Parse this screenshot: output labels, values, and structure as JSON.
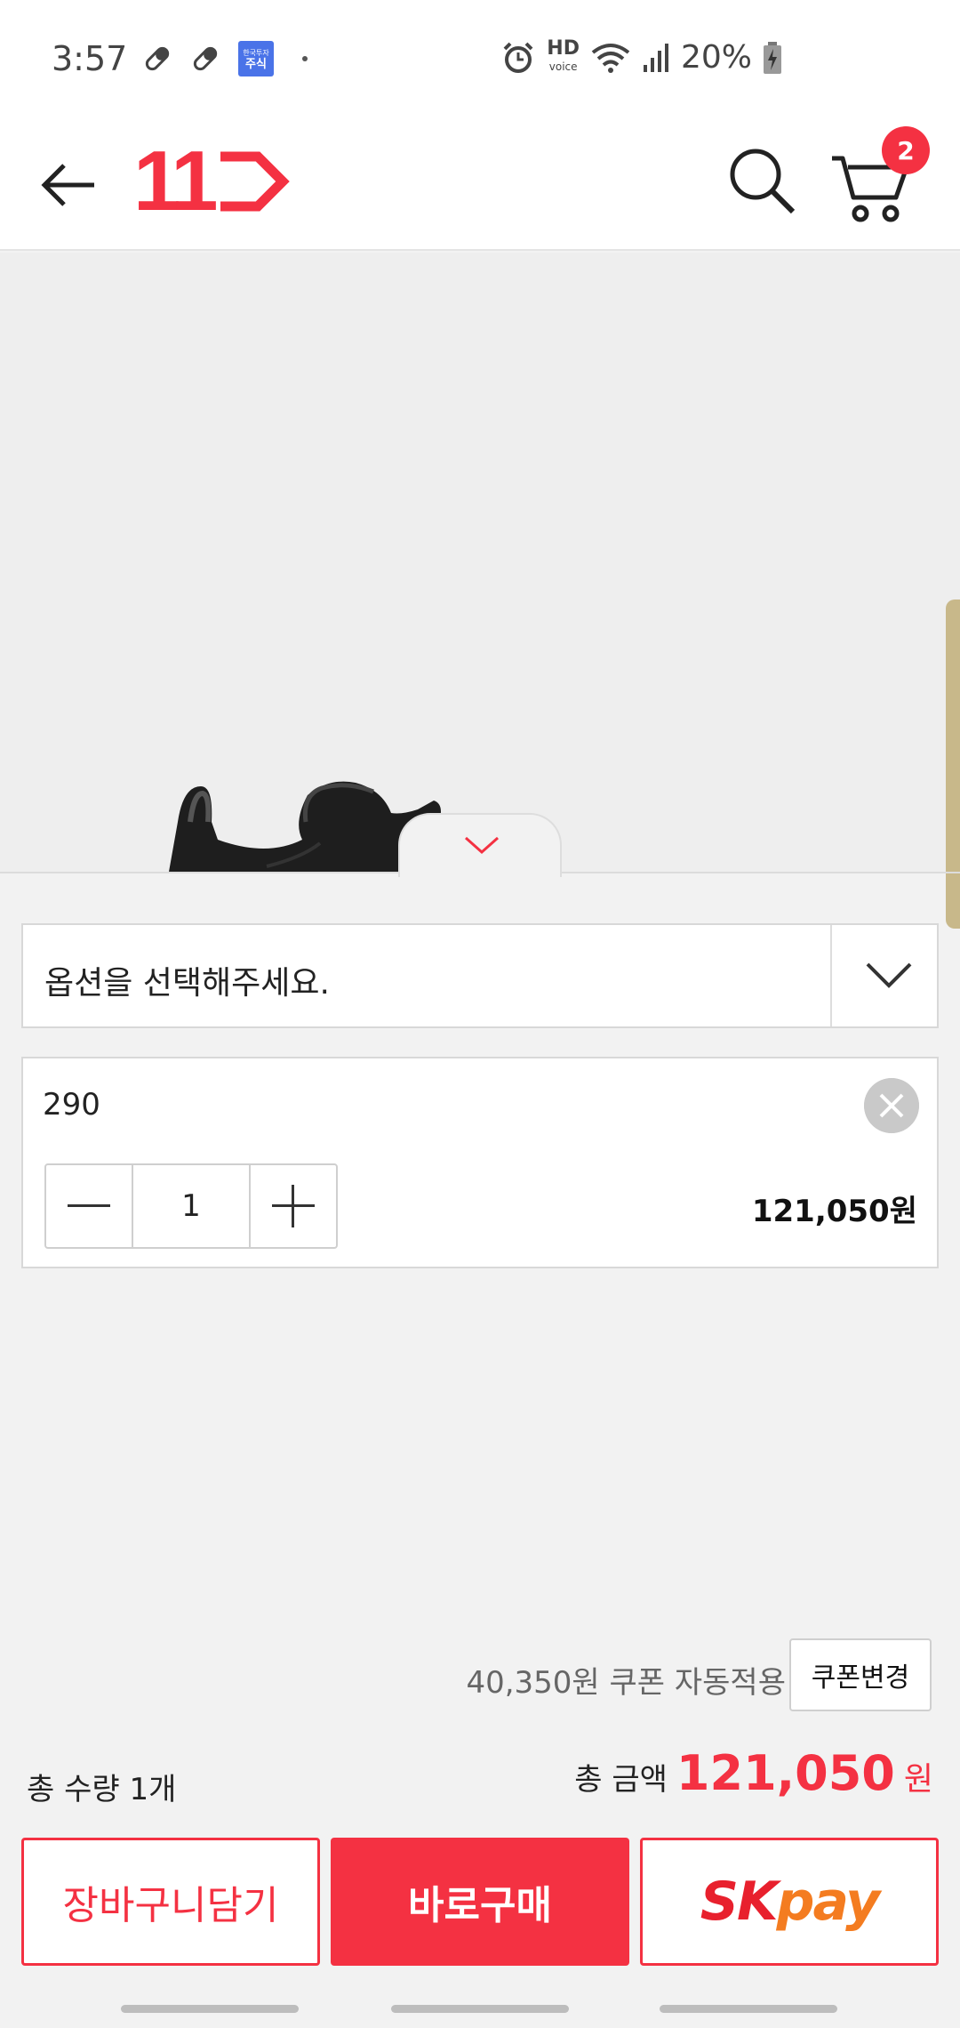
{
  "status_bar": {
    "time": "3:57",
    "stock_badge_top": "한국투자",
    "stock_badge_label": "주식",
    "hd_label": "HD",
    "voice_label": "voice",
    "battery_text": "20%"
  },
  "header": {
    "cart_count": "2",
    "logo_text": "11"
  },
  "option_select": {
    "placeholder": "옵션을 선택해주세요."
  },
  "selected_item": {
    "name": "290",
    "quantity": "1",
    "price": "121,050원"
  },
  "coupon": {
    "text": "40,350원 쿠폰 자동적용",
    "button_label": "쿠폰변경"
  },
  "totals": {
    "quantity_text": "총 수량 1개",
    "amount_label": "총 금액",
    "amount_value": "121,050",
    "amount_unit": "원"
  },
  "actions": {
    "cart_label": "장바구니담기",
    "buy_label": "바로구매",
    "skpay_sk": "SK",
    "skpay_pay": "pay"
  },
  "colors": {
    "brand_red": "#f43142",
    "skpay_orange": "#f47c20"
  }
}
